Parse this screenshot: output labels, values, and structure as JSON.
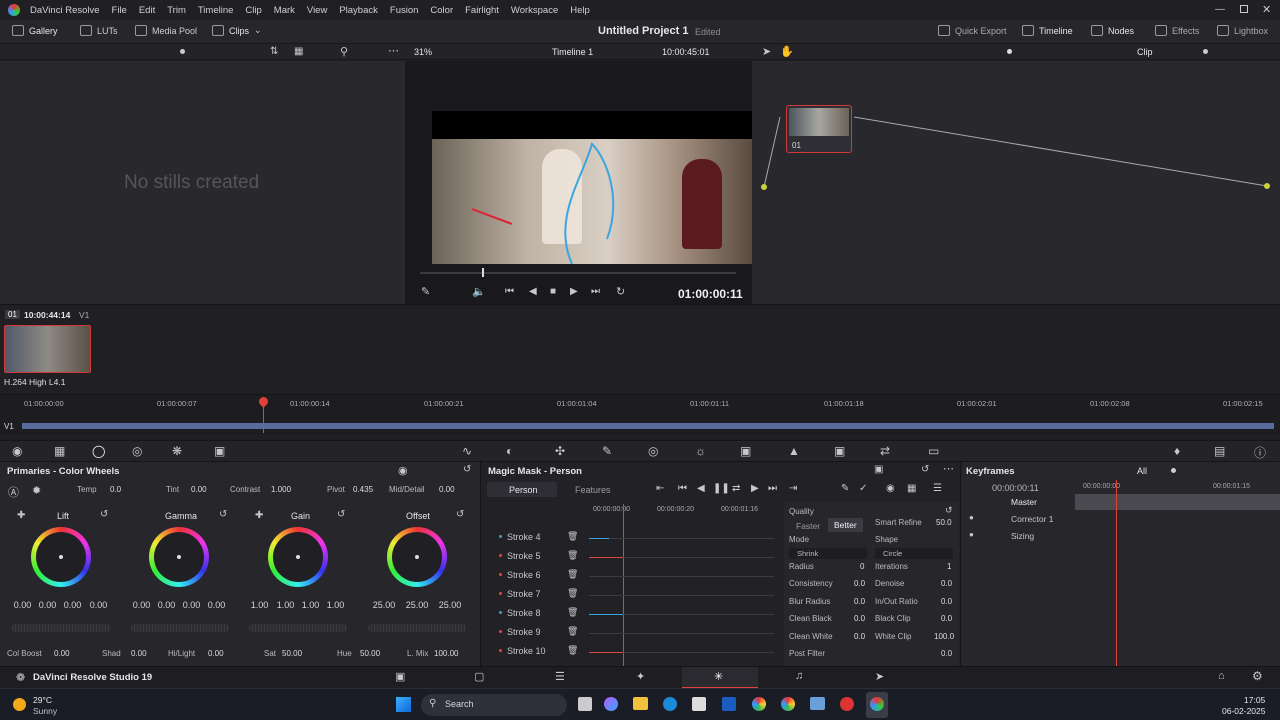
{
  "app": {
    "name": "DaVinci Resolve",
    "project_title": "Untitled Project 1",
    "project_status": "Edited"
  },
  "menu": [
    "DaVinci Resolve",
    "File",
    "Edit",
    "Trim",
    "Timeline",
    "Clip",
    "Mark",
    "View",
    "Playback",
    "Fusion",
    "Color",
    "Fairlight",
    "Workspace",
    "Help"
  ],
  "toolbar": {
    "gallery": "Gallery",
    "luts": "LUTs",
    "media_pool": "Media Pool",
    "clips": "Clips",
    "quick_export": "Quick Export",
    "timeline": "Timeline",
    "nodes": "Nodes",
    "effects": "Effects",
    "lightbox": "Lightbox"
  },
  "viewer": {
    "zoom": "31%",
    "timeline_name": "Timeline 1",
    "timecode": "10:00:45:01",
    "playhead_tc": "01:00:00:11",
    "mode": "Clip"
  },
  "stills": {
    "empty_text": "No stills created"
  },
  "node": {
    "label": "01"
  },
  "clip": {
    "number": "01",
    "timecode": "10:00:44:14",
    "track": "V1",
    "codec": "H.264 High L4.1"
  },
  "ruler": [
    "01:00:00:00",
    "01:00:00:07",
    "01:00:00:14",
    "01:00:00:21",
    "01:00:01:04",
    "01:00:01:11",
    "01:00:01:18",
    "01:00:02:01",
    "01:00:02:08",
    "01:00:02:15"
  ],
  "track_label": "V1",
  "primaries": {
    "title": "Primaries - Color Wheels",
    "temp_label": "Temp",
    "temp": "0.0",
    "tint_label": "Tint",
    "tint": "0.00",
    "contrast_label": "Contrast",
    "contrast": "1.000",
    "pivot_label": "Pivot",
    "pivot": "0.435",
    "mid_label": "Mid/Detail",
    "mid": "0.00",
    "wheels": [
      {
        "name": "Lift",
        "values": [
          "0.00",
          "0.00",
          "0.00",
          "0.00"
        ]
      },
      {
        "name": "Gamma",
        "values": [
          "0.00",
          "0.00",
          "0.00",
          "0.00"
        ]
      },
      {
        "name": "Gain",
        "values": [
          "1.00",
          "1.00",
          "1.00",
          "1.00"
        ]
      },
      {
        "name": "Offset",
        "values": [
          "25.00",
          "25.00",
          "25.00"
        ]
      }
    ],
    "bottom": {
      "colboost_label": "Col Boost",
      "colboost": "0.00",
      "shad_label": "Shad",
      "shad": "0.00",
      "hilight_label": "Hi/Light",
      "hilight": "0.00",
      "sat_label": "Sat",
      "sat": "50.00",
      "hue_label": "Hue",
      "hue": "50.00",
      "lmix_label": "L. Mix",
      "lmix": "100.00"
    }
  },
  "mask": {
    "title": "Magic Mask - Person",
    "tab_person": "Person",
    "tab_features": "Features",
    "times": [
      "00:00:00:00",
      "00:00:00:20",
      "00:00:01:16"
    ],
    "strokes": [
      "Stroke 4",
      "Stroke 5",
      "Stroke 6",
      "Stroke 7",
      "Stroke 8",
      "Stroke 9",
      "Stroke 10"
    ],
    "quality_label": "Quality",
    "faster": "Faster",
    "better": "Better",
    "smart_refine_label": "Smart Refine",
    "smart_refine": "50.0",
    "mode_label": "Mode",
    "mode": "Shrink",
    "shape_label": "Shape",
    "shape": "Circle",
    "params": [
      {
        "l": "Radius",
        "v": "0",
        "l2": "Iterations",
        "v2": "1"
      },
      {
        "l": "Consistency",
        "v": "0.0",
        "l2": "Denoise",
        "v2": "0.0"
      },
      {
        "l": "Blur Radius",
        "v": "0.0",
        "l2": "In/Out Ratio",
        "v2": "0.0"
      },
      {
        "l": "Clean Black",
        "v": "0.0",
        "l2": "Black Clip",
        "v2": "0.0"
      },
      {
        "l": "Clean White",
        "v": "0.0",
        "l2": "White Clip",
        "v2": "100.0"
      },
      {
        "l": "Post Filter",
        "v": "",
        "l2": "",
        "v2": "0.0"
      }
    ]
  },
  "keyframes": {
    "title": "Keyframes",
    "filter": "All",
    "timecode": "00:00:00:11",
    "ruler": [
      "00:00:00:00",
      "00:00:01:15"
    ],
    "rows": [
      "Master",
      "Corrector 1",
      "Sizing"
    ]
  },
  "footer": {
    "app_name": "DaVinci Resolve Studio 19"
  },
  "taskbar": {
    "temp": "29°C",
    "weather": "Sunny",
    "search": "Search",
    "time": "17:05",
    "date": "06-02-2025"
  },
  "colors": {
    "accent_red": "#e0413a",
    "bg": "#1f1f24"
  }
}
